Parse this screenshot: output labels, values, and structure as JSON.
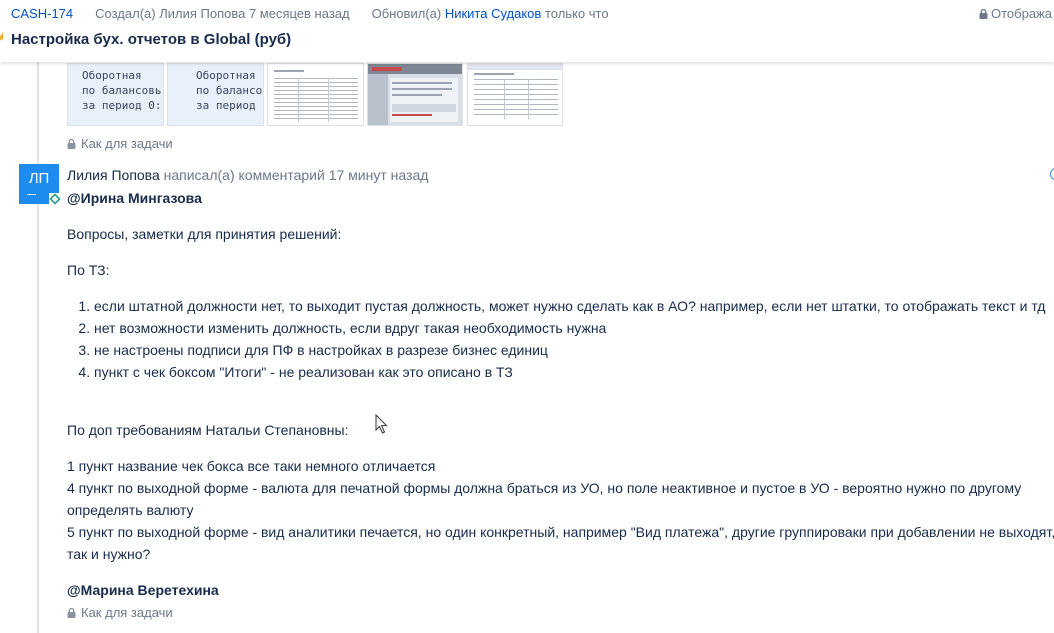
{
  "issue": {
    "key": "CASH-174",
    "created_prefix": "Создал(а)",
    "creator": "Лилия Попова",
    "created_ago": "7 месяцев назад",
    "updated_prefix": "Обновил(а)",
    "updater": "Никита Судаков",
    "updated_ago": "только что",
    "restriction_label": "Отобража",
    "title": "Настройка бух. отчетов в Global (руб)"
  },
  "attachments": {
    "thumb1_text": "Оборотная\nпо балансовь\nза период 0:",
    "thumb2_text": "Оборотная\nпо балансов\nза период ("
  },
  "visibility_label": "Как для задачи",
  "comment": {
    "avatar_initials": "ЛП",
    "author": "Лилия Попова",
    "action": "написал(а) комментарий",
    "ago": "17 минут назад",
    "mention1": "@Ирина Мингазова",
    "intro": "Вопросы, заметки для принятия решений:",
    "tz_heading": "По ТЗ:",
    "tz_items": [
      "если штатной должности нет, то выходит пустая должность, может нужно сделать как в АО? например, если нет штатки, то отображать текст и тд",
      "нет возможности изменить должность, если вдруг такая необходимость нужна",
      "не настроены подписи для ПФ в настройках в разрезе бизнес единиц",
      "пункт с чек боксом \"Итоги\" - не реализован как это описано в ТЗ"
    ],
    "extra_heading": "По доп требованиям Натальи Степановны:",
    "extra_lines": [
      "1 пункт название чек бокса все таки немного отличается",
      "4 пункт по выходной форме - валюта для печатной формы должна браться из УО, но поле неактивное и пустое в УО - вероятно нужно по другому определять валюту",
      "5 пункт по выходной форме - вид аналитики печается, но один конкретный, например \"Вид платежа\", другие группироваки при добавлении не выходят, так и нужно?"
    ],
    "mention2": "@Марина Веретехина"
  },
  "colors": {
    "link": "#0052cc",
    "avatar": "#1e8bef",
    "muted": "#6b778c",
    "text": "#172b4d"
  }
}
